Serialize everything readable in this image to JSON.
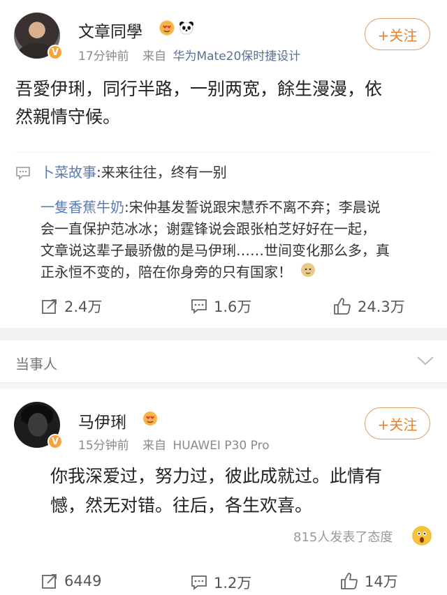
{
  "post1": {
    "author": "文章同學",
    "verified_badge": "V",
    "emoji_badges": [
      "lover-face-icon",
      "panda-icon"
    ],
    "time": "17分钟前",
    "source_prefix": "来自",
    "source": "华为Mate20保时捷设计",
    "follow_label": "+关注",
    "content_line1": "吾愛伊琍，同行半路，一别两宽，餘生漫漫，依",
    "content_line2": "然親情守候。",
    "comments": [
      {
        "name": "卜菜故事",
        "text": ":来来往往，终有一别"
      },
      {
        "name": "一隻香蕉牛奶",
        "line1": ":宋仲基发誓说跟宋慧乔不离不弃；李晨说",
        "line2": "会一直保护范冰冰；谢霆锋说会跟张柏芝好好在一起，",
        "line3": "文章说这辈子最骄傲的是马伊琍……世间变化那么多，真",
        "line4": "正永恒不变的，陪在你身旁的只有国家！"
      }
    ],
    "actions": {
      "repost": "2.4万",
      "comment": "1.6万",
      "like": "24.3万"
    }
  },
  "section_label": "当事人",
  "post2": {
    "author": "马伊琍",
    "verified_badge": "V",
    "emoji_badges": [
      "lover-face-icon"
    ],
    "time": "15分钟前",
    "source_prefix": "来自",
    "source": "HUAWEI P30 Pro",
    "follow_label": "+关注",
    "content_line1": "你我深爱过，努力过，彼此成就过。此情有",
    "content_line2": "憾，然无对错。往后，各生欢喜。",
    "attitude_text": "815人发表了态度",
    "actions": {
      "repost": "6449",
      "comment": "1.2万",
      "like": "14万"
    }
  },
  "colors": {
    "accent": "#e8812e",
    "link": "#5b7bb5",
    "badge": "#f7a23b"
  }
}
